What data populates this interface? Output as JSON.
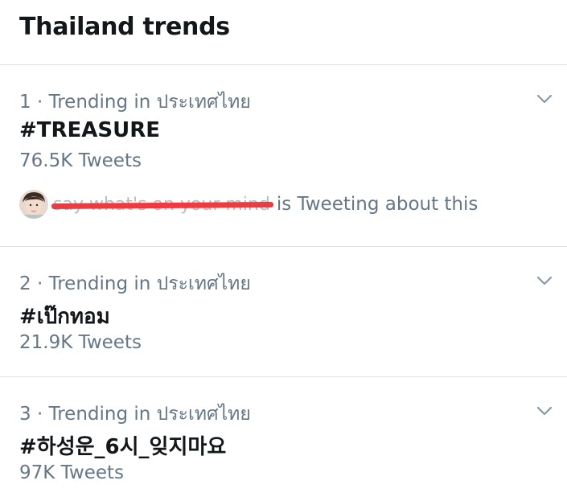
{
  "header": {
    "title": "Thailand trends"
  },
  "trends": [
    {
      "meta": "1 · Trending in ประเทศไทย",
      "topic": "#TREASURE",
      "count": "76.5K Tweets",
      "context": {
        "user_redacted": "say what's on your mind",
        "text": "is Tweeting about this"
      }
    },
    {
      "meta": "2 · Trending in ประเทศไทย",
      "topic": "#เป๊กทอม",
      "count": "21.9K Tweets"
    },
    {
      "meta": "3 · Trending in ประเทศไทย",
      "topic": "#하성운_6시_잊지마요",
      "count": "97K Tweets"
    }
  ],
  "icons": {
    "chevron": "chevron-down-icon",
    "avatar": "avatar"
  },
  "colors": {
    "text_primary": "#14171a",
    "text_secondary": "#657786",
    "divider": "#dfe3e6",
    "redaction": "#f03a3f"
  }
}
